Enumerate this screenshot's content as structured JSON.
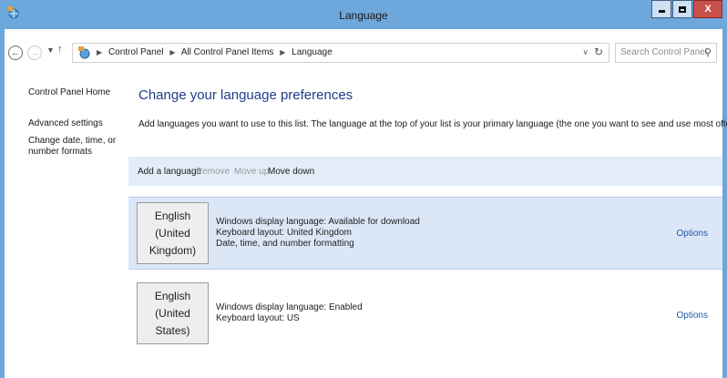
{
  "window": {
    "title": "Language",
    "close_label": "X"
  },
  "address": {
    "crumbs": [
      "Control Panel",
      "All Control Panel Items",
      "Language"
    ]
  },
  "search": {
    "placeholder": "Search Control Panel"
  },
  "sidebar": {
    "items": [
      {
        "label": "Control Panel Home"
      },
      {
        "label": "Advanced settings"
      },
      {
        "label": "Change date, time, or number formats"
      }
    ]
  },
  "main": {
    "heading": "Change your language preferences",
    "description": "Add languages you want to use to this list. The language at the top of your list is your primary language (the one you want to see and use most often)."
  },
  "toolbar": {
    "add": "Add a language",
    "remove": "Remove",
    "move_up": "Move up",
    "move_down": "Move down"
  },
  "languages": [
    {
      "name_line1": "English (United",
      "name_line2": "Kingdom)",
      "details": [
        "Windows display language: Available for download",
        "Keyboard layout: United Kingdom",
        "Date, time, and number formatting"
      ],
      "options": "Options",
      "selected": true
    },
    {
      "name_line1": "English (United",
      "name_line2": "States)",
      "details": [
        "Windows display language: Enabled",
        "Keyboard layout: US"
      ],
      "options": "Options",
      "selected": false
    }
  ],
  "colors": {
    "frame": "#6ea7dc",
    "heading": "#1e3c8a",
    "link": "#1e5ba5",
    "toolbar_bg": "#e3edf9",
    "selected_row": "#dbe7f7"
  },
  "icons": [
    "language-globe-icon",
    "back-arrow-icon",
    "forward-arrow-icon",
    "recent-dropdown-icon",
    "up-arrow-icon",
    "refresh-icon",
    "search-icon"
  ]
}
